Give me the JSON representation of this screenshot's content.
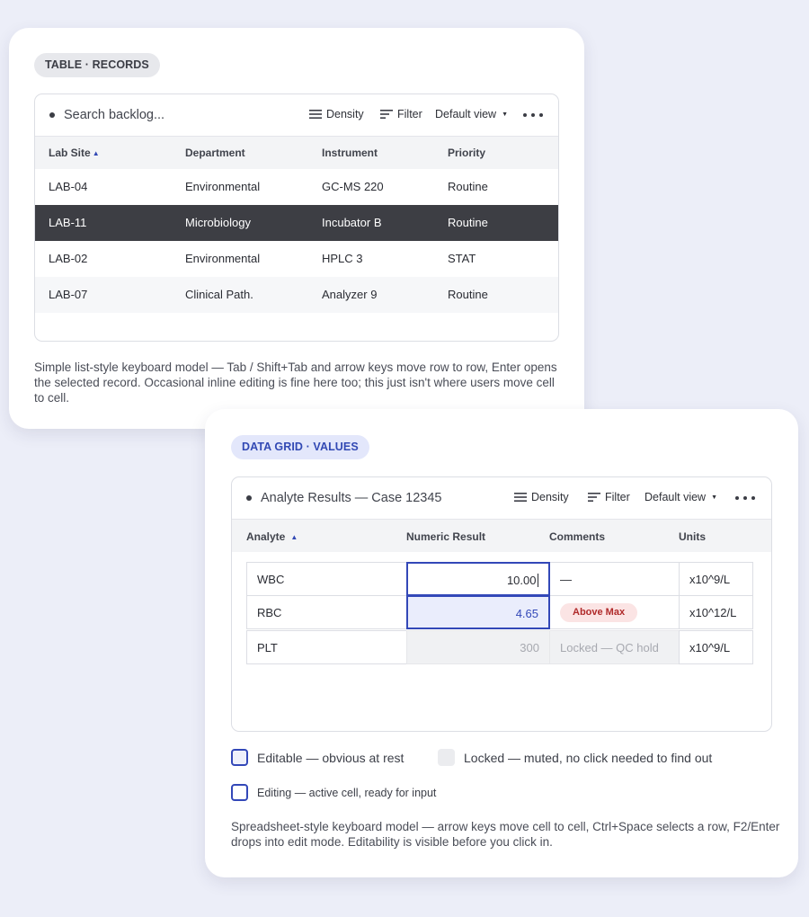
{
  "table_card": {
    "tag": "TABLE · RECORDS",
    "toolbar": {
      "search_placeholder": "Search backlog...",
      "density_label": "Density",
      "filter_label": "Filter",
      "view_label": "Default view"
    },
    "columns": [
      "Lab Site",
      "Department",
      "Instrument",
      "Priority"
    ],
    "sort_indicator": "▲",
    "rows": [
      {
        "site": "LAB-04",
        "department": "Environmental",
        "instrument": "GC-MS 220",
        "priority": "Routine"
      },
      {
        "site": "LAB-11",
        "department": "Microbiology",
        "instrument": "Incubator B",
        "priority": "Routine"
      },
      {
        "site": "LAB-02",
        "department": "Environmental",
        "instrument": "HPLC 3",
        "priority": "STAT"
      },
      {
        "site": "LAB-07",
        "department": "Clinical Path.",
        "instrument": "Analyzer 9",
        "priority": "Routine"
      }
    ],
    "selected_row_index": 1,
    "description": "Simple list-style keyboard model — Tab / Shift+Tab and arrow keys move row to row, Enter opens the selected record. Occasional inline editing is fine here too; this just isn't where users move cell to cell."
  },
  "grid_card": {
    "tag": "DATA GRID · VALUES",
    "toolbar": {
      "title": "Analyte Results — Case 12345",
      "density_label": "Density",
      "filter_label": "Filter",
      "view_label": "Default view"
    },
    "columns": [
      "Analyte",
      "Numeric Result",
      "Comments",
      "Units"
    ],
    "sort_indicator": "▲",
    "rows": [
      {
        "analyte": "WBC",
        "result": "10.00",
        "comment": "—",
        "units": "x10^9/L",
        "state": "editing"
      },
      {
        "analyte": "RBC",
        "result": "4.65",
        "comment": "Above Max",
        "units": "x10^12/L",
        "state": "editable"
      },
      {
        "analyte": "PLT",
        "result": "300",
        "comment": "Locked — QC hold",
        "units": "x10^9/L",
        "state": "locked"
      }
    ],
    "legend": {
      "editable": "Editable — obvious at rest",
      "locked": "Locked — muted, no click needed to find out",
      "editing": "Editing — active cell, ready for input"
    },
    "description": "Spreadsheet-style keyboard model — arrow keys move cell to cell, Ctrl+Space selects a row, F2/Enter drops into edit mode. Editability is visible before you click in."
  },
  "colors": {
    "accent": "#3348b8",
    "selected_row": "#3d3e44",
    "warning_pill_bg": "#fbe4e4",
    "warning_pill_text": "#b02a2a"
  }
}
